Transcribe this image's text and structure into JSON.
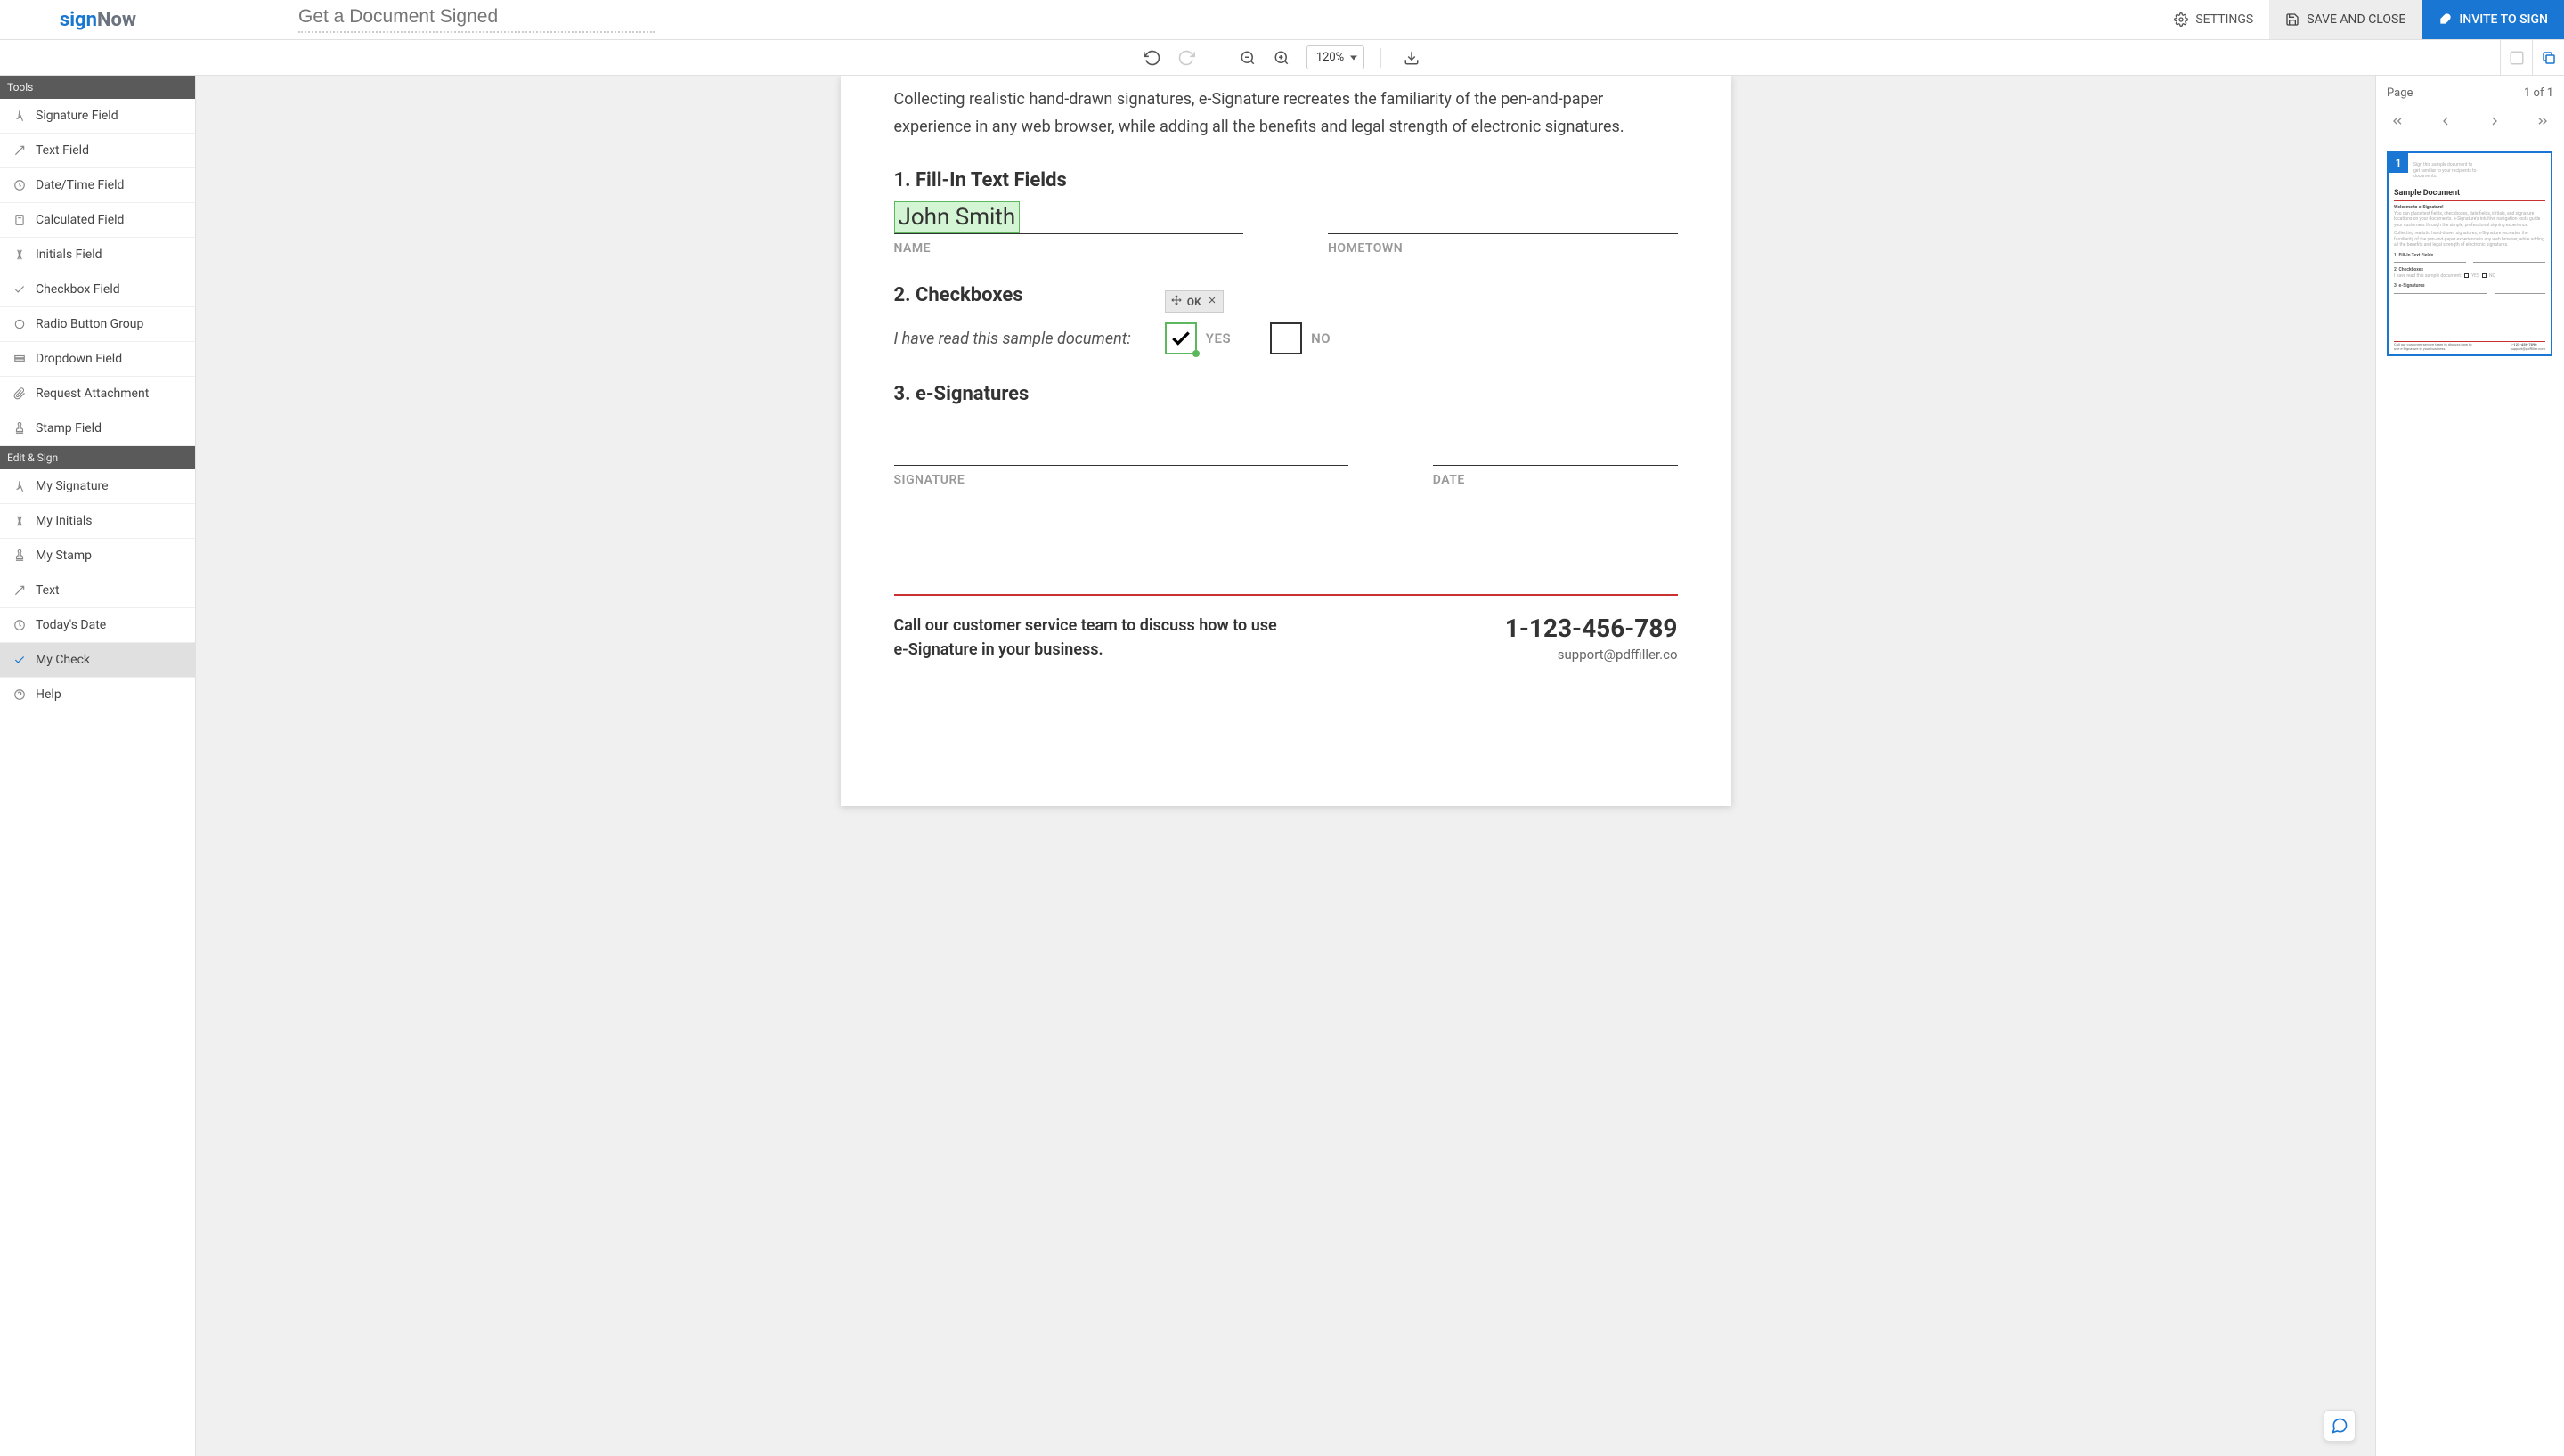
{
  "header": {
    "logo_first": "sign",
    "logo_second": "Now",
    "doc_title_placeholder": "Get a Document Signed",
    "settings_label": "SETTINGS",
    "save_label": "SAVE AND CLOSE",
    "invite_label": "INVITE TO SIGN"
  },
  "toolbar": {
    "zoom_value": "120%"
  },
  "sidebar": {
    "tools_header": "Tools",
    "editsign_header": "Edit & Sign",
    "tools": [
      {
        "label": "Signature Field",
        "icon": "signature"
      },
      {
        "label": "Text Field",
        "icon": "text"
      },
      {
        "label": "Date/Time Field",
        "icon": "clock"
      },
      {
        "label": "Calculated Field",
        "icon": "calc"
      },
      {
        "label": "Initials Field",
        "icon": "initials"
      },
      {
        "label": "Checkbox Field",
        "icon": "check"
      },
      {
        "label": "Radio Button Group",
        "icon": "radio"
      },
      {
        "label": "Dropdown Field",
        "icon": "dropdown"
      },
      {
        "label": "Request Attachment",
        "icon": "attach"
      },
      {
        "label": "Stamp Field",
        "icon": "stamp"
      }
    ],
    "editsign": [
      {
        "label": "My Signature",
        "icon": "signature",
        "active": false
      },
      {
        "label": "My Initials",
        "icon": "initials",
        "active": false
      },
      {
        "label": "My Stamp",
        "icon": "stamp",
        "active": false
      },
      {
        "label": "Text",
        "icon": "text",
        "active": false
      },
      {
        "label": "Today's Date",
        "icon": "clock",
        "active": false
      },
      {
        "label": "My Check",
        "icon": "check",
        "active": true
      },
      {
        "label": "Help",
        "icon": "help",
        "active": false
      }
    ]
  },
  "document": {
    "intro": "Collecting realistic hand-drawn signatures, e-Signature recreates the familiarity of the pen-and-paper experience in any web browser, while adding all the benefits and legal strength of electronic signatures.",
    "h1": "1. Fill-In Text Fields",
    "name_value": "John Smith",
    "name_label": "NAME",
    "hometown_label": "HOMETOWN",
    "h2": "2. Checkboxes",
    "check_prompt": "I have read this sample document:",
    "yes_label": "YES",
    "no_label": "NO",
    "ok_label": "OK",
    "h3": "3. e-Signatures",
    "sig_label": "SIGNATURE",
    "date_label": "DATE",
    "footer_text": "Call our customer service team to discuss how to use e-Signature in your business.",
    "footer_phone": "1-123-456-789",
    "footer_email": "support@pdffiller.co"
  },
  "right_panel": {
    "page_label": "Page",
    "page_count": "1 of 1",
    "thumb_num": "1",
    "thumb_title": "Sample Document",
    "thumb_welcome": "Welcome to e-Signature!"
  }
}
